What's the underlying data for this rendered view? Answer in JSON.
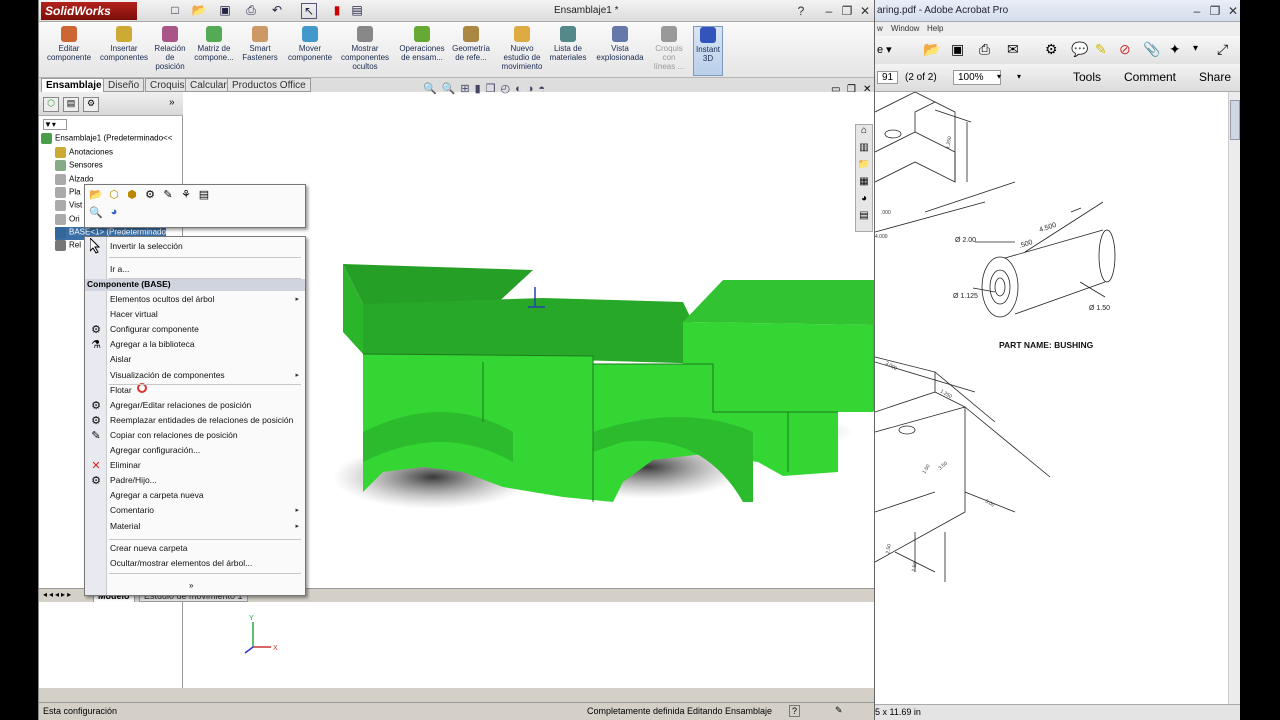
{
  "solidworks": {
    "app_name": "SolidWorks",
    "document_title": "Ensamblaje1 *",
    "commands": [
      {
        "label": "Editar\ncomponente"
      },
      {
        "label": "Insertar\ncomponentes"
      },
      {
        "label": "Relación\nde\nposición"
      },
      {
        "label": "Matriz de\ncompone..."
      },
      {
        "label": "Smart\nFasteners"
      },
      {
        "label": "Mover\ncomponente"
      },
      {
        "label": "Mostrar\ncomponentes\nocultos"
      },
      {
        "label": "Operaciones\nde ensam..."
      },
      {
        "label": "Geometría\nde refe..."
      },
      {
        "label": "Nuevo\nestudio de\nmovimiento"
      },
      {
        "label": "Lista de\nmateriales"
      },
      {
        "label": "Vista\nexplosionada"
      },
      {
        "label": "Croquis\ncon\nlíneas ..."
      },
      {
        "label": "Instant\n3D"
      }
    ],
    "tabs": [
      "Ensamblaje",
      "Diseño",
      "Croquis",
      "Calcular",
      "Productos Office"
    ],
    "tree": {
      "root": "Ensamblaje1  (Predeterminado<<",
      "items": [
        "Anotaciones",
        "Sensores",
        "Alzado",
        "Pla",
        "Vist",
        "Ori",
        "BASE<1> (Predeterminado",
        "Rel"
      ]
    },
    "bottom_tabs": [
      "Modelo",
      "Estudio de movimiento 1"
    ],
    "status": {
      "left": "Esta configuración",
      "defined": "Completamente definida",
      "mode": "Editando Ensamblaje",
      "help": "?"
    },
    "context_menu": {
      "items_top": [
        "Invertir la selección",
        "Ir a..."
      ],
      "header": "Componente (BASE)",
      "items": [
        {
          "label": "Elementos ocultos del árbol",
          "submenu": true
        },
        {
          "label": "Hacer virtual"
        },
        {
          "label": "Configurar componente"
        },
        {
          "label": "Agregar a la biblioteca"
        },
        {
          "label": "Aislar"
        },
        {
          "label": "Visualización de componentes",
          "submenu": true
        },
        {
          "label": "Flotar"
        },
        {
          "label": "Agregar/Editar relaciones de posición"
        },
        {
          "label": "Reemplazar entidades de relaciones de posición"
        },
        {
          "label": "Copiar con relaciones de posición"
        },
        {
          "label": "Agregar configuración..."
        },
        {
          "label": "Eliminar"
        },
        {
          "label": "Padre/Hijo..."
        },
        {
          "label": "Agregar a carpeta nueva"
        },
        {
          "label": "Comentario",
          "submenu": true
        },
        {
          "label": "Material",
          "submenu": true
        }
      ],
      "items_bottom": [
        "Crear nueva carpeta",
        "Ocultar/mostrar elementos del árbol..."
      ],
      "expand": "»"
    },
    "part_color": "#2fd22f"
  },
  "acrobat": {
    "title": "aring.pdf - Adobe Acrobat Pro",
    "menu": [
      "w",
      "Window",
      "Help"
    ],
    "page_number": "91",
    "page_of": "(2 of 2)",
    "zoom": "100%",
    "nav": [
      "Tools",
      "Comment",
      "Share"
    ],
    "status": "5 x 11.69 in",
    "drawing": {
      "part_name": "PART NAME: BUSHING",
      "dims": [
        "1.250",
        "4.500",
        ".500",
        "Ø 2.00",
        "Ø 1.125",
        "Ø 1.50",
        ".000",
        "4.000",
        "3.000",
        "1.250",
        "5.00",
        "1.50",
        "2.50",
        "3.50",
        "2.50"
      ]
    }
  }
}
